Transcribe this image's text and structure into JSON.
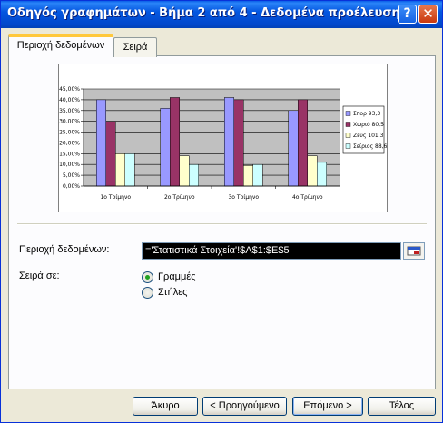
{
  "window": {
    "title": "Οδηγός γραφημάτων - Βήμα 2 από 4 - Δεδομένα προέλευσης",
    "help_label": "?",
    "close_label": "✕"
  },
  "tabs": [
    {
      "label": "Περιοχή δεδομένων",
      "active": true
    },
    {
      "label": "Σειρά",
      "active": false
    }
  ],
  "chart_data": {
    "type": "bar",
    "categories": [
      "1ο Τρίμηνο",
      "2ο Τρίμηνο",
      "3ο Τρίμηνο",
      "4ο Τρίμηνο"
    ],
    "series": [
      {
        "name": "Σπορ 93,3",
        "color": "#9999FF",
        "values": [
          0.4,
          0.36,
          0.41,
          0.35
        ]
      },
      {
        "name": "Χωριό 80,5",
        "color": "#993366",
        "values": [
          0.3,
          0.41,
          0.4,
          0.4
        ]
      },
      {
        "name": "Ζεύς 101,3",
        "color": "#FFFFCC",
        "values": [
          0.15,
          0.14,
          0.095,
          0.14
        ]
      },
      {
        "name": "Σείριος 88,6",
        "color": "#CCFFFF",
        "values": [
          0.15,
          0.1,
          0.1,
          0.11
        ]
      }
    ],
    "y_ticks": [
      "0,00%",
      "5,00%",
      "10,00%",
      "15,00%",
      "20,00%",
      "25,00%",
      "30,00%",
      "35,00%",
      "40,00%",
      "45,00%"
    ],
    "ylim": [
      0,
      0.45
    ],
    "grid": true,
    "legend_position": "right",
    "plot_background": "#C0C0C0"
  },
  "form": {
    "range_label": "Περιοχή δεδομένων:",
    "range_value": "='Στατιστικά Στοιχεία'!$A$1:$E$5",
    "series_in_label": "Σειρά σε:",
    "options": [
      {
        "label": "Γραμμές",
        "selected": true
      },
      {
        "label": "Στήλες",
        "selected": false
      }
    ]
  },
  "buttons": {
    "cancel": "Άκυρο",
    "back": "< Προηγούμενο",
    "next": "Επόμενο >",
    "finish": "Τέλος"
  }
}
